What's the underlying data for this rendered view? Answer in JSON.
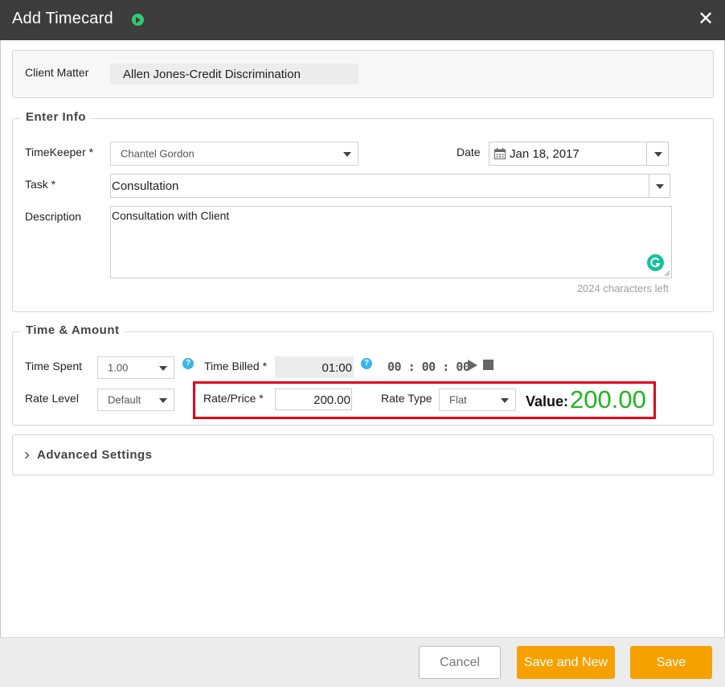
{
  "dialog": {
    "title": "Add Timecard"
  },
  "client_matter": {
    "label": "Client Matter",
    "value": "Allen Jones-Credit Discrimination"
  },
  "enter_info": {
    "legend": "Enter Info",
    "timekeeper_label": "TimeKeeper *",
    "timekeeper_value": "Chantel Gordon",
    "date_label": "Date",
    "date_value": "Jan 18, 2017",
    "task_label": "Task *",
    "task_value": "Consultation",
    "description_label": "Description",
    "description_value": "Consultation with Client",
    "chars_left": "2024 characters left"
  },
  "time_amount": {
    "legend": "Time & Amount",
    "time_spent_label": "Time Spent",
    "time_spent_value": "1.00",
    "time_billed_label": "Time Billed *",
    "time_billed_value": "01:00",
    "timer_display": "00 : 00 : 00",
    "rate_level_label": "Rate Level",
    "rate_level_value": "Default",
    "rate_price_label": "Rate/Price *",
    "rate_price_value": "200.00",
    "rate_type_label": "Rate Type",
    "rate_type_value": "Flat",
    "value_label": "Value:",
    "value_amount": "200.00"
  },
  "advanced": {
    "label": "Advanced Settings"
  },
  "footer": {
    "cancel": "Cancel",
    "save_and_new": "Save and New",
    "save": "Save"
  },
  "colors": {
    "titlebar": "#3d3d3d",
    "accent_orange": "#f7a100",
    "value_green": "#22b422",
    "highlight_red": "#e0001b",
    "help_blue": "#3cb4e7"
  }
}
